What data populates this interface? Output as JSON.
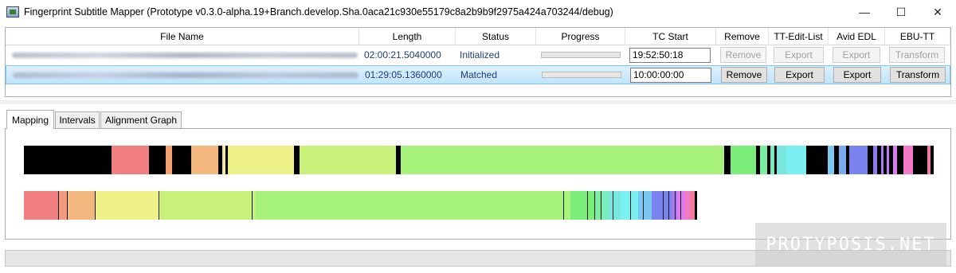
{
  "window": {
    "title": "Fingerprint Subtitle Mapper (Prototype v0.3.0-alpha.19+Branch.develop.Sha.0aca21c930e55179c8a2b9b9f2975a424a703244/debug)",
    "minimize_glyph": "—",
    "maximize_glyph": "☐",
    "close_glyph": "✕"
  },
  "grid": {
    "columns": [
      "File Name",
      "Length",
      "Status",
      "Progress",
      "TC Start",
      "Remove",
      "TT-Edit-List",
      "Avid EDL",
      "EBU-TT"
    ],
    "rows": [
      {
        "length": "02:00:21.5040000",
        "status": "Initialized",
        "progress": 0,
        "tc_start": "19:52:50:18",
        "remove": "Remove",
        "tt_edit_list": "Export",
        "avid_edl": "Export",
        "ebu_tt": "Transform",
        "buttons_enabled": false
      },
      {
        "length": "01:29:05.1360000",
        "status": "Matched",
        "progress": 0,
        "tc_start": "10:00:00:00",
        "remove": "Remove",
        "tt_edit_list": "Export",
        "avid_edl": "Export",
        "ebu_tt": "Transform",
        "buttons_enabled": true
      }
    ]
  },
  "tabs": [
    "Mapping",
    "Intervals",
    "Alignment Graph"
  ],
  "active_tab": "Mapping",
  "mapping": {
    "track1": [
      {
        "w": 0.093,
        "c": "#000000"
      },
      {
        "w": 0.039,
        "c": "#f27f7f"
      },
      {
        "w": 0.018,
        "c": "#000000"
      },
      {
        "w": 0.007,
        "c": "#f2a070"
      },
      {
        "w": 0.02,
        "c": "#000000"
      },
      {
        "w": 0.029,
        "c": "#f2b87f"
      },
      {
        "w": 0.004,
        "c": "#000000"
      },
      {
        "w": 0.003,
        "c": "#efe9a0"
      },
      {
        "w": 0.003,
        "c": "#000000"
      },
      {
        "w": 0.07,
        "c": "#eef088"
      },
      {
        "w": 0.006,
        "c": "#000000"
      },
      {
        "w": 0.102,
        "c": "#c8f07a"
      },
      {
        "w": 0.005,
        "c": "#000000"
      },
      {
        "w": 0.342,
        "c": "#a6f27a"
      },
      {
        "w": 0.007,
        "c": "#000000"
      },
      {
        "w": 0.027,
        "c": "#7aed7a"
      },
      {
        "w": 0.004,
        "c": "#000000"
      },
      {
        "w": 0.008,
        "c": "#7aeda0"
      },
      {
        "w": 0.003,
        "c": "#000000"
      },
      {
        "w": 0.004,
        "c": "#7aedc0"
      },
      {
        "w": 0.003,
        "c": "#000000"
      },
      {
        "w": 0.01,
        "c": "#7ae6e0"
      },
      {
        "w": 0.021,
        "c": "#7af0f0"
      },
      {
        "w": 0.023,
        "c": "#000000"
      },
      {
        "w": 0.007,
        "c": "#7ac8f2"
      },
      {
        "w": 0.005,
        "c": "#000000"
      },
      {
        "w": 0.007,
        "c": "#7aaaf2"
      },
      {
        "w": 0.004,
        "c": "#000000"
      },
      {
        "w": 0.019,
        "c": "#7a82f0"
      },
      {
        "w": 0.006,
        "c": "#000000"
      },
      {
        "w": 0.004,
        "c": "#8f7af2"
      },
      {
        "w": 0.004,
        "c": "#000000"
      },
      {
        "w": 0.003,
        "c": "#a87af2"
      },
      {
        "w": 0.003,
        "c": "#000000"
      },
      {
        "w": 0.003,
        "c": "#c07af2"
      },
      {
        "w": 0.004,
        "c": "#000000"
      },
      {
        "w": 0.004,
        "c": "#dc7af2"
      },
      {
        "w": 0.007,
        "c": "#000000"
      },
      {
        "w": 0.01,
        "c": "#f27ac8"
      },
      {
        "w": 0.015,
        "c": "#000000"
      },
      {
        "w": 0.004,
        "c": "#f27aa0"
      },
      {
        "w": 0.003,
        "c": "#000000"
      }
    ],
    "track2": [
      {
        "w": 0.051,
        "c": "#f27f7f"
      },
      {
        "w": 0.013,
        "c": "#f29a7f"
      },
      {
        "w": 0.041,
        "c": "#f2b87f"
      },
      {
        "w": 0.095,
        "c": "#eef088"
      },
      {
        "w": 0.139,
        "c": "#c8f07a"
      },
      {
        "w": 0.462,
        "c": "#a6f27a"
      },
      {
        "w": 0.036,
        "c": "#7aed7a"
      },
      {
        "w": 0.01,
        "c": "#7aeda0"
      },
      {
        "w": 0.01,
        "c": "#7aedc0"
      },
      {
        "w": 0.017,
        "c": "#7ae6e0"
      },
      {
        "w": 0.026,
        "c": "#7af0f0"
      },
      {
        "w": 0.019,
        "c": "#7ac8f2"
      },
      {
        "w": 0.03,
        "c": "#7a82f0"
      },
      {
        "w": 0.008,
        "c": "#a87af2"
      },
      {
        "w": 0.01,
        "c": "#dc7af2"
      },
      {
        "w": 0.008,
        "c": "#f27ac8"
      },
      {
        "w": 0.008,
        "c": "#f27aa0"
      },
      {
        "w": 0.003,
        "c": "#000000"
      }
    ],
    "track2_lines": [
      0.051,
      0.064,
      0.105,
      0.2,
      0.339,
      0.801,
      0.837,
      0.847,
      0.857,
      0.874,
      0.9,
      0.919,
      0.949,
      0.957,
      0.967,
      0.975
    ]
  },
  "watermark": "PROTYPOSIS.NET"
}
